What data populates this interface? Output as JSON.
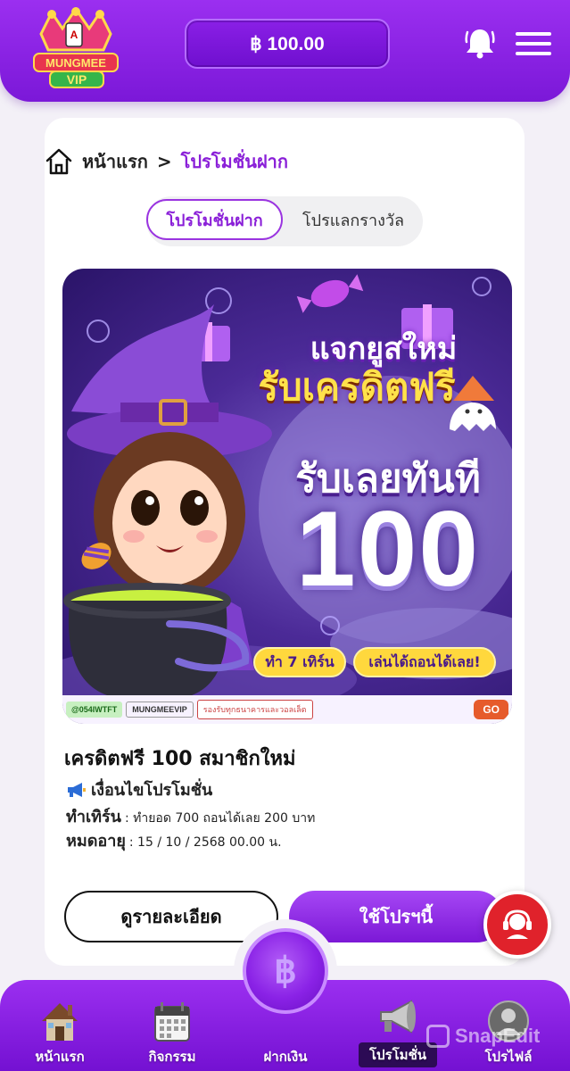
{
  "header": {
    "logo_text": "MUNGMEE VIP",
    "balance": "฿ 100.00"
  },
  "breadcrumb": {
    "home": "หน้าแรก",
    "separator": ">",
    "current": "โปรโมชั่นฝาก"
  },
  "tabs": [
    {
      "label": "โปรโมชั่นฝาก",
      "active": true
    },
    {
      "label": "โปรแลกรางวัล",
      "active": false
    }
  ],
  "banner": {
    "headline_1": "แจกยูสใหม่",
    "headline_2": "รับเครดิตฟรี",
    "headline_3": "รับเลยทันที",
    "amount": "100",
    "pill_1": "ทำ 7 เทิร์น",
    "pill_2": "เล่นได้ถอนได้เลย!",
    "footer": {
      "line_id": "@054IWTFT",
      "google": "MUNGMEEVIP",
      "bank": "รองรับทุกธนาคารและวอลเล็ต",
      "go": "GO"
    }
  },
  "promo": {
    "title": "เครดิตฟรี 100 สมาชิกใหม่",
    "conditions_label": "เงื่อนไขโปรโมชั่น",
    "turnover_label": "ทำเทิร์น",
    "turnover_value": ": ทำยอด 700 ถอนได้เลย 200 บาท",
    "expiry_label": "หมดอายุ",
    "expiry_value": ": 15 / 10 / 2568 00.00 น."
  },
  "buttons": {
    "details": "ดูรายละเอียด",
    "use": "ใช้โปรฯนี้"
  },
  "bottom_nav": {
    "center_symbol": "฿",
    "items": [
      {
        "label": "หน้าแรก",
        "icon": "house-icon"
      },
      {
        "label": "กิจกรรม",
        "icon": "calendar-icon"
      },
      {
        "label": "ฝากเงิน",
        "icon": "deposit-icon"
      },
      {
        "label": "โปรโมชั่น",
        "icon": "megaphone-icon",
        "active": true
      },
      {
        "label": "โปรไฟล์",
        "icon": "profile-icon"
      }
    ]
  },
  "watermark": "SnapEdit",
  "colors": {
    "primary": "#8a1fd8",
    "accent_yellow": "#ffd83d",
    "support_red": "#e0222b"
  }
}
